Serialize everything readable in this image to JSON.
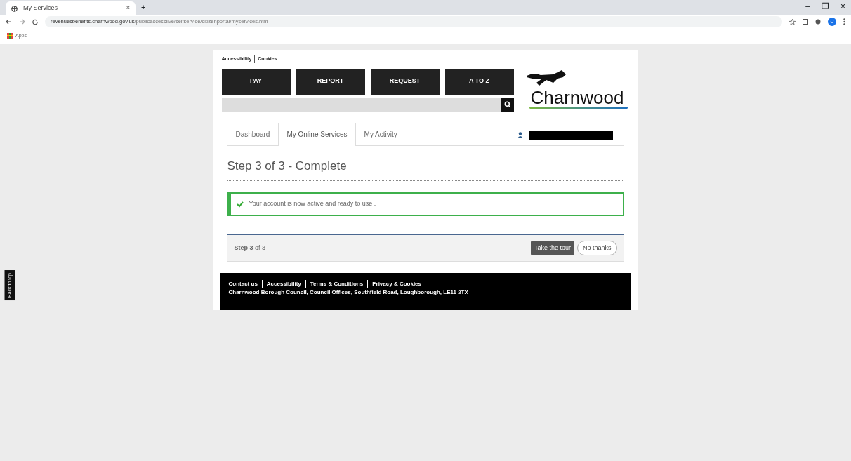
{
  "browser": {
    "tab_title": "My Services",
    "new_tab": "+",
    "tab_close": "×",
    "url_host": "revenuesbenefits.charnwood.gov.uk",
    "url_path": "/publicaccesslive/selfservice/citizenportal/myservices.htm",
    "bookmarks": [
      "Apps"
    ],
    "profile_initial": "C",
    "window_controls": [
      "–",
      "❐",
      "×"
    ]
  },
  "top_links": [
    "Accessibility",
    "Cookies"
  ],
  "nav_buttons": [
    "PAY",
    "REPORT",
    "REQUEST",
    "A TO Z"
  ],
  "logo": {
    "text": "Charnwood"
  },
  "tabs": [
    {
      "label": "Dashboard",
      "selected": false
    },
    {
      "label": "My Online Services",
      "selected": true
    },
    {
      "label": "My Activity",
      "selected": false
    }
  ],
  "user_menu": {
    "redacted": true
  },
  "heading": "Step 3 of 3 - Complete",
  "alert": {
    "kind": "success",
    "text": "Your account is now active and ready to use ."
  },
  "tour_bar": {
    "step": "**Step 3** of 3",
    "buttons": [
      {
        "label": "Take the tour",
        "kind": "primary"
      },
      {
        "label": "No thanks",
        "kind": "outline"
      }
    ]
  },
  "footer": {
    "links": [
      "Contact us",
      "Accessibility",
      "Terms & Conditions",
      "Privacy & Cookies"
    ],
    "address": "Charnwood Borough Council, Council Offices, Southfield Road, Loughborough, LE11 2TX"
  },
  "back_to_top": "Back to top"
}
